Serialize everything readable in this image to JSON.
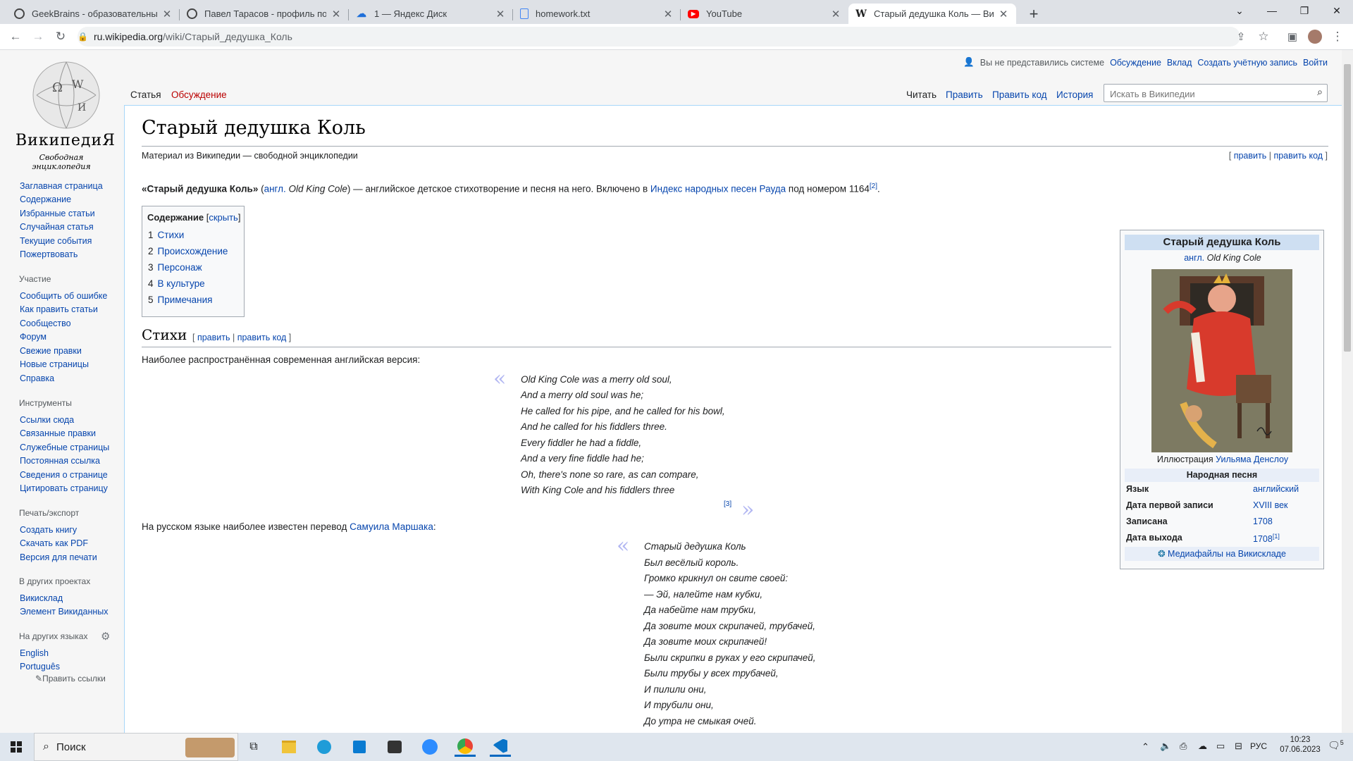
{
  "browser": {
    "tabs": [
      {
        "title": "GeekBrains - образовательный п",
        "favicon": "geekbrains-icon"
      },
      {
        "title": "Павел Тарасов - профиль польз",
        "favicon": "geekbrains-icon"
      },
      {
        "title": "1 — Яндекс Диск",
        "favicon": "yandex-disk-icon"
      },
      {
        "title": "homework.txt",
        "favicon": "file-icon"
      },
      {
        "title": "YouTube",
        "favicon": "youtube-icon"
      },
      {
        "title": "Старый дедушка Коль — Википе",
        "favicon": "wikipedia-icon"
      }
    ],
    "url_host": "ru.wikipedia.org",
    "url_path": "/wiki/Старый_дедушка_Коль"
  },
  "wiki": {
    "logo_title": "ВикипедиЯ",
    "logo_subtitle": "Свободная энциклопедия",
    "personal": {
      "not_logged": "Вы не представились системе",
      "talk": "Обсуждение",
      "contribs": "Вклад",
      "create": "Создать учётную запись",
      "login": "Войти"
    },
    "tabs": {
      "article": "Статья",
      "discussion": "Обсуждение",
      "read": "Читать",
      "edit": "Править",
      "edit_source": "Править код",
      "history": "История"
    },
    "search_placeholder": "Искать в Википедии",
    "nav": {
      "main": [
        "Заглавная страница",
        "Содержание",
        "Избранные статьи",
        "Случайная статья",
        "Текущие события",
        "Пожертвовать"
      ],
      "participation_header": "Участие",
      "participation": [
        "Сообщить об ошибке",
        "Как править статьи",
        "Сообщество",
        "Форум",
        "Свежие правки",
        "Новые страницы",
        "Справка"
      ],
      "tools_header": "Инструменты",
      "tools": [
        "Ссылки сюда",
        "Связанные правки",
        "Служебные страницы",
        "Постоянная ссылка",
        "Сведения о странице",
        "Цитировать страницу"
      ],
      "print_header": "Печать/экспорт",
      "print": [
        "Создать книгу",
        "Скачать как PDF",
        "Версия для печати"
      ],
      "projects_header": "В других проектах",
      "projects": [
        "Викисклад",
        "Элемент Викиданных"
      ],
      "languages_header": "На других языках",
      "languages": [
        "English",
        "Português"
      ],
      "edit_links": "Править ссылки"
    },
    "article": {
      "title": "Старый дедушка Коль",
      "from": "Материал из Википедии — свободной энциклопедии",
      "edit_links": {
        "open": "[ ",
        "edit": "править",
        "sep": " | ",
        "edit_source": "править код",
        "close": " ]"
      },
      "intro": {
        "bold": "«Старый дедушка Коль»",
        "p1": " (",
        "lang": "англ.",
        "orig": " Old King Cole",
        "p2": ") — английское детское стихотворение и песня на него. Включено в ",
        "link": "Индекс народных песен Рауда",
        "p3": " под номером 1164",
        "ref": "[2]",
        "end": "."
      },
      "toc": {
        "title": "Содержание",
        "hide": "скрыть",
        "items": [
          {
            "num": "1",
            "label": "Стихи"
          },
          {
            "num": "2",
            "label": "Происхождение"
          },
          {
            "num": "3",
            "label": "Персонаж"
          },
          {
            "num": "4",
            "label": "В культуре"
          },
          {
            "num": "5",
            "label": "Примечания"
          }
        ]
      },
      "section_title": "Стихи",
      "section_edit": "править",
      "section_edit_source": "править код",
      "p_english": "Наиболее распространённая современная английская версия:",
      "poem_en": [
        "Old King Cole was a merry old soul,",
        "And a merry old soul was he;",
        "He called for his pipe, and he called for his bowl,",
        "And he called for his fiddlers three.",
        "Every fiddler he had a fiddle,",
        "And a very fine fiddle had he;",
        "Oh, there's none so rare, as can compare,",
        "With King Cole and his fiddlers three"
      ],
      "poem_en_ref": "[3]",
      "p_russian_pre": "На русском языке наиболее известен перевод ",
      "p_russian_link": "Самуила Маршака",
      "p_russian_post": ":",
      "poem_ru": [
        "Старый дедушка Коль",
        "Был весёлый король.",
        "Громко крикнул он свите своей:",
        "— Эй, налейте нам кубки,",
        "Да набейте нам трубки,",
        "Да зовите моих скрипачей, трубачей,",
        "Да зовите моих скрипачей!",
        "Были скрипки в руках у его скрипачей,",
        "Были трубы у всех трубачей,",
        "И пилили они,",
        "И трубили они,",
        "До утра не смыкая очей."
      ]
    },
    "infobox": {
      "title": "Старый дедушка Коль",
      "subtitle_lang": "англ.",
      "subtitle": " Old King Cole",
      "caption_pre": "Иллюстрация ",
      "caption_link": "Уильяма Денслоу",
      "section": "Народная песня",
      "rows": [
        {
          "key": "Язык",
          "value": "английский",
          "ref": ""
        },
        {
          "key": "Дата первой записи",
          "value": "XVIII век",
          "ref": ""
        },
        {
          "key": "Записана",
          "value": "1708",
          "ref": ""
        },
        {
          "key": "Дата выхода",
          "value": "1708",
          "ref": "[1]"
        }
      ],
      "commons": "Медиафайлы на Викискладе"
    }
  },
  "taskbar": {
    "search": "Поиск",
    "lang": "РУС",
    "time": "10:23",
    "date": "07.06.2023",
    "notifications": "5"
  }
}
